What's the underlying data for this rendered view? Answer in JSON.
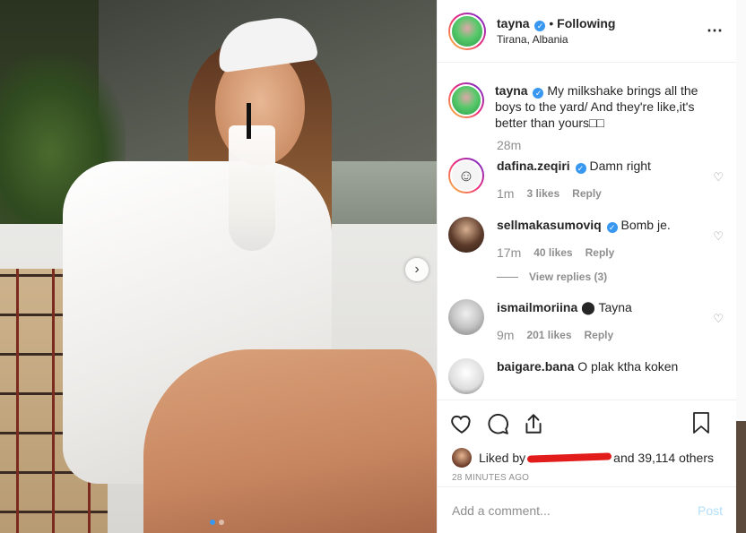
{
  "post": {
    "author": "tayna",
    "follow_status": "Following",
    "separator": "•",
    "location": "Tirana, Albania",
    "more_icon": "⋯",
    "caption": "My milkshake brings all the boys to the yard/ And they're like,it's better than yours□□",
    "caption_time": "28m"
  },
  "comments": [
    {
      "user": "dafina.zeqiri",
      "verified": true,
      "text": "Damn right",
      "time": "1m",
      "likes": "3 likes",
      "reply": "Reply"
    },
    {
      "user": "sellmakasumoviq",
      "verified": true,
      "text": "Bomb je.",
      "time": "17m",
      "likes": "40 likes",
      "reply": "Reply",
      "view_replies": "View replies (3)"
    },
    {
      "user": "ismailmoriina",
      "verified": false,
      "text": "⬤ Tayna",
      "time": "9m",
      "likes": "201 likes",
      "reply": "Reply"
    },
    {
      "user": "baigare.bana",
      "text": "O plak ktha koken"
    }
  ],
  "likes_line": {
    "prefix": "Liked by",
    "suffix": "and 39,114 others"
  },
  "timestamp": "28 MINUTES AGO",
  "add_comment": {
    "placeholder": "Add a comment...",
    "post_label": "Post"
  },
  "colors": {
    "accent": "#3897f0",
    "post_disabled": "#b2dffc",
    "muted": "#8e8e8e",
    "redaction": "#e21b1b"
  }
}
